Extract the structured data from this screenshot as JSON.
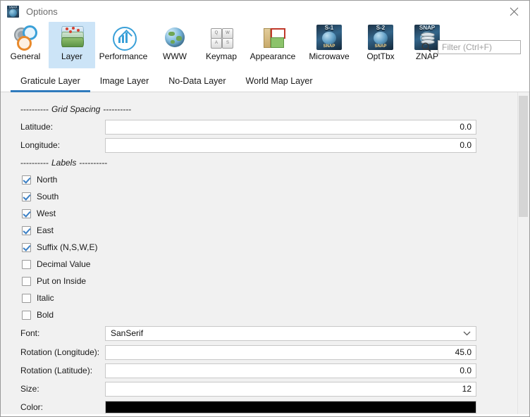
{
  "window": {
    "title": "Options",
    "app_icon": "snap-options-icon",
    "snap_badge": "SNAP",
    "close_label": "Close"
  },
  "toolbar": {
    "categories": [
      {
        "label": "General",
        "icon": "gears-icon",
        "selected": false
      },
      {
        "label": "Layer",
        "icon": "layers-icon",
        "selected": true
      },
      {
        "label": "Performance",
        "icon": "performance-icon",
        "selected": false
      },
      {
        "label": "WWW",
        "icon": "globe-icon",
        "selected": false
      },
      {
        "label": "Keymap",
        "icon": "keyboard-icon",
        "selected": false
      },
      {
        "label": "Appearance",
        "icon": "appearance-icon",
        "selected": false
      },
      {
        "label": "Microwave",
        "icon": "sentinel1-icon",
        "selected": false,
        "badge": "S-1",
        "foot": "SNAP"
      },
      {
        "label": "OptTbx",
        "icon": "sentinel2-icon",
        "selected": false,
        "badge": "S-2",
        "foot": "SNAP"
      },
      {
        "label": "ZNAP",
        "icon": "znap-icon",
        "selected": false,
        "badge": "SNAP"
      }
    ]
  },
  "search": {
    "icon": "search-icon",
    "placeholder": "Filter (Ctrl+F)",
    "value": ""
  },
  "tabs": [
    {
      "label": "Graticule Layer",
      "active": true
    },
    {
      "label": "Image Layer",
      "active": false
    },
    {
      "label": "No-Data Layer",
      "active": false
    },
    {
      "label": "World Map Layer",
      "active": false
    }
  ],
  "panel": {
    "section_grid_spacing": {
      "dash_left": "----------",
      "title": "Grid Spacing",
      "dash_right": "----------"
    },
    "latitude": {
      "label": "Latitude:",
      "value": "0.0"
    },
    "longitude": {
      "label": "Longitude:",
      "value": "0.0"
    },
    "section_labels": {
      "dash_left": "----------",
      "title": "Labels",
      "dash_right": "----------"
    },
    "checkboxes": [
      {
        "label": "North",
        "checked": true
      },
      {
        "label": "South",
        "checked": true
      },
      {
        "label": "West",
        "checked": true
      },
      {
        "label": "East",
        "checked": true
      },
      {
        "label": "Suffix (N,S,W,E)",
        "checked": true
      },
      {
        "label": "Decimal Value",
        "checked": false
      },
      {
        "label": "Put on Inside",
        "checked": false
      },
      {
        "label": "Italic",
        "checked": false
      },
      {
        "label": "Bold",
        "checked": false
      }
    ],
    "font": {
      "label": "Font:",
      "value": "SanSerif"
    },
    "rotation_longitude": {
      "label": "Rotation (Longitude):",
      "value": "45.0"
    },
    "rotation_latitude": {
      "label": "Rotation (Latitude):",
      "value": "0.0"
    },
    "size": {
      "label": "Size:",
      "value": "12"
    },
    "color": {
      "label": "Color:",
      "value": "#000000"
    }
  },
  "scrollbar": {
    "orientation": "vertical"
  },
  "colors": {
    "accent": "#2f7bbd",
    "selection": "#cce4f7",
    "panel_bg": "#f1f1f1",
    "color_swatch": "#000000"
  }
}
